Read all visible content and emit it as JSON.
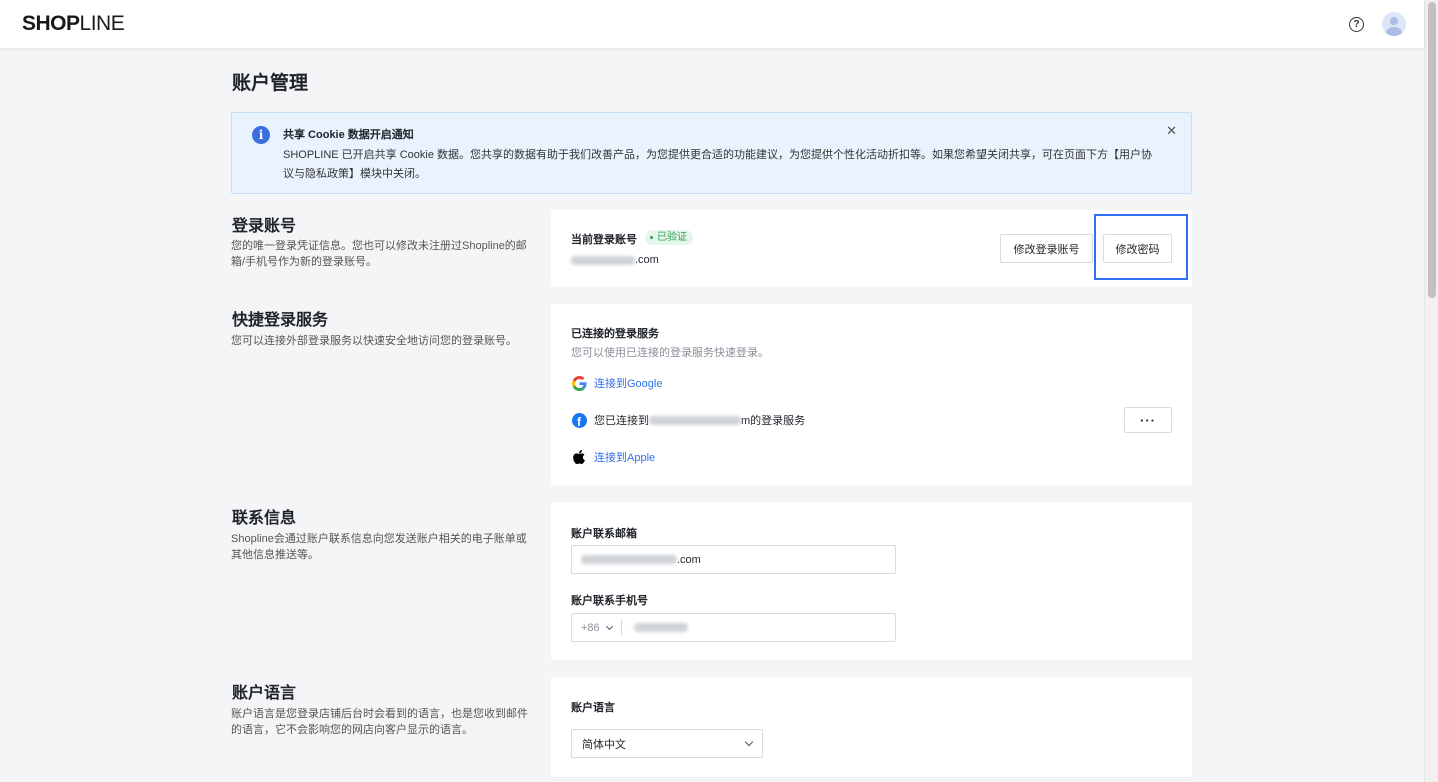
{
  "header": {
    "logo_bold": "SHOP",
    "logo_thin": "LINE",
    "help_glyph": "?"
  },
  "page": {
    "title": "账户管理"
  },
  "notice": {
    "icon_glyph": "i",
    "title": "共享 Cookie 数据开启通知",
    "body": "SHOPLINE 已开启共享 Cookie 数据。您共享的数据有助于我们改善产品，为您提供更合适的功能建议，为您提供个性化活动折扣等。如果您希望关闭共享，可在页面下方【用户协议与隐私政策】模块中关闭。",
    "close_glyph": "✕"
  },
  "login_account": {
    "title": "登录账号",
    "desc": "您的唯一登录凭证信息。您也可以修改未注册过Shopline的邮箱/手机号作为新的登录账号。",
    "current_label": "当前登录账号",
    "verified_badge": "已验证",
    "email_suffix": ".com",
    "change_account_button": "修改登录账号",
    "change_password_button": "修改密码"
  },
  "quick_login": {
    "title": "快捷登录服务",
    "desc": "您可以连接外部登录服务以快速安全地访问您的登录账号。",
    "connected_title": "已连接的登录服务",
    "connected_desc": "您可以使用已连接的登录服务快速登录。",
    "google_link": "连接到Google",
    "facebook_prefix": "您已连接到",
    "facebook_suffix": "m的登录服务",
    "more_glyph": "···",
    "apple_link": "连接到Apple"
  },
  "contact": {
    "title": "联系信息",
    "desc": "Shopline会通过账户联系信息向您发送账户相关的电子账单或其他信息推送等。",
    "email_label": "账户联系邮箱",
    "email_suffix": ".com",
    "phone_label": "账户联系手机号",
    "country_code": "+86"
  },
  "language": {
    "title": "账户语言",
    "desc": "账户语言是您登录店铺后台时会看到的语言，也是您收到邮件的语言，它不会影响您的网店向客户显示的语言。",
    "field_label": "账户语言",
    "selected": "简体中文"
  },
  "colors": {
    "accent": "#2f6ff0",
    "notice_bg": "#e8f3fe",
    "verified": "#2f9f56"
  },
  "icons": [
    "help-icon",
    "avatar",
    "info-icon",
    "close-icon",
    "google-icon",
    "facebook-icon",
    "apple-icon",
    "more-icon",
    "chevron-down-icon"
  ]
}
